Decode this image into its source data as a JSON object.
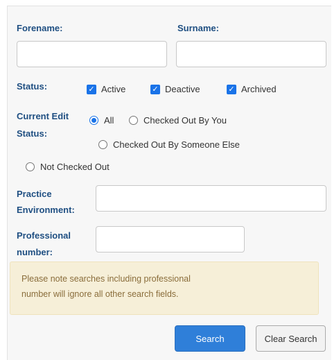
{
  "form": {
    "forename_label": "Forename:",
    "surname_label": "Surname:",
    "forename_value": "",
    "surname_value": "",
    "status_label": "Status:",
    "status_options": [
      {
        "label": "Active",
        "checked": true
      },
      {
        "label": "Deactive",
        "checked": true
      },
      {
        "label": "Archived",
        "checked": true
      }
    ],
    "edit_status_label_line1": "Current Edit",
    "edit_status_label_line2": "Status:",
    "edit_status_options": [
      {
        "label": "All",
        "selected": true
      },
      {
        "label": "Checked Out By You",
        "selected": false
      },
      {
        "label": "Checked Out By Someone Else",
        "selected": false
      },
      {
        "label": "Not Checked Out",
        "selected": false
      }
    ],
    "practice_label_line1": "Practice",
    "practice_label_line2": "Environment:",
    "practice_value": "",
    "professional_label_line1": "Professional",
    "professional_label_line2": "number:",
    "professional_value": ""
  },
  "notice": {
    "line1": "Please note searches including professional",
    "line2": "number will ignore all other search fields."
  },
  "buttons": {
    "search": "Search",
    "clear": "Clear Search"
  },
  "colors": {
    "label": "#1f4f82",
    "accent": "#1a73e8",
    "alert_bg": "#f6efd8",
    "alert_text": "#8a6d3b"
  }
}
